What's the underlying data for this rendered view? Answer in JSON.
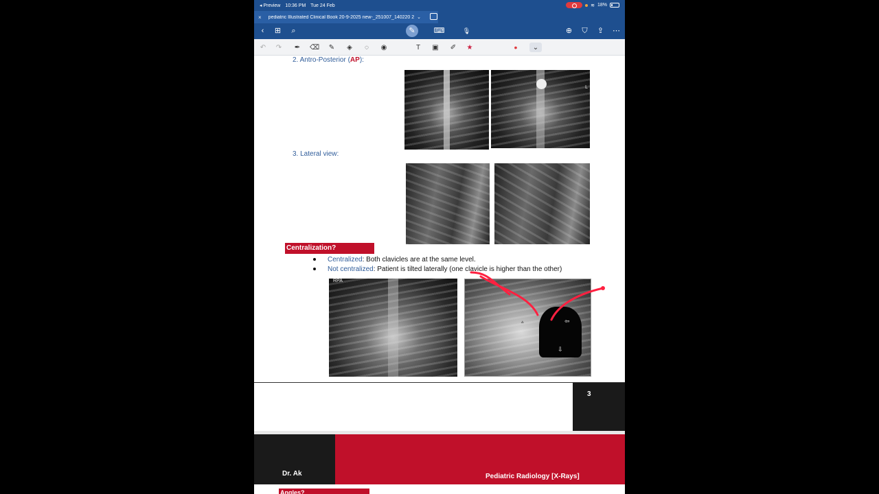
{
  "status": {
    "back_app": "◂ Preview",
    "time": "10:36 PM",
    "date": "Tue 24 Feb",
    "battery": "18%"
  },
  "tab": {
    "close": "×",
    "title": "pediatric Illustrated Clinical Book 20-9-2025 new-_251007_140220 2",
    "chevron": "⌄"
  },
  "toolbar": {
    "back": "‹",
    "grid": "⊞",
    "search": "⌕",
    "pen": "✎",
    "keyboard": "⌨",
    "mic": "🎙",
    "page_add": "⊕",
    "bookmark": "⛉",
    "share": "⇪",
    "more": "⋯"
  },
  "ink": {
    "undo": "↶",
    "redo": "↷",
    "pen": "✒",
    "eraser": "⌫",
    "highlighter": "✎",
    "lasso_shapes": "◈",
    "lasso": "◌",
    "stamp": "◉",
    "text": "T",
    "image": "▣",
    "ruler": "✐",
    "favorite": "★",
    "color": "•",
    "more": "⌄"
  },
  "doc": {
    "sec2_prefix": "2.   Antro-Posterior (",
    "sec2_red": "AP",
    "sec2_suffix": "):",
    "sec3": "3.   Lateral view:",
    "img_label_L": "L",
    "img_label_RPA": "RPA",
    "centralization_title": "Centralization?",
    "bullet1_term": "Centralized",
    "bullet1_text": ": Both clavicles are at the same level.",
    "bullet2_term": "Not centralized",
    "bullet2_text": ": Patient is tilted laterally (one clavicle is higher than the other)",
    "page_number": "3",
    "footer_author": "Dr. Ak",
    "footer_title": "Pediatric Radiology [X-Rays]",
    "next_section": "Angles?"
  }
}
